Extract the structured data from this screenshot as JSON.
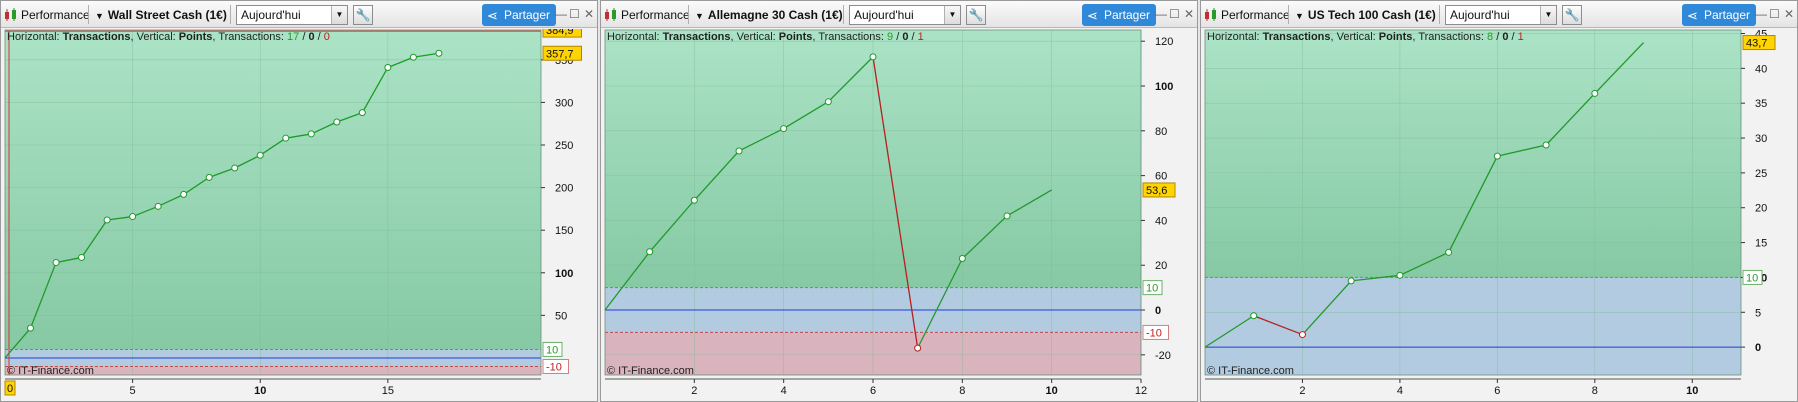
{
  "panels": [
    {
      "toolbar": {
        "perf": "Performance",
        "title": "Wall Street Cash (1€)",
        "period": "Aujourd'hui",
        "share": "Partager"
      },
      "info": {
        "h_label": "Horizontal: ",
        "h_val": "Transactions",
        "v_label": ", Vertical: ",
        "v_val": "Points",
        "t_label": ", Transactions: ",
        "t_win": "17",
        "sep1": " / ",
        "t_zero": "0",
        "sep2": " / ",
        "t_loss": "0"
      },
      "credit": "© IT-Finance.com",
      "markers": {
        "top": "384,9",
        "last": "357,7",
        "plus": "10",
        "minus": "-10",
        "x0": "0"
      }
    },
    {
      "toolbar": {
        "perf": "Performance",
        "title": "Allemagne 30 Cash (1€)",
        "period": "Aujourd'hui",
        "share": "Partager"
      },
      "info": {
        "h_label": "Horizontal: ",
        "h_val": "Transactions",
        "v_label": ", Vertical: ",
        "v_val": "Points",
        "t_label": ", Transactions: ",
        "t_win": "9",
        "sep1": " / ",
        "t_zero": "0",
        "sep2": " / ",
        "t_loss": "1"
      },
      "credit": "© IT-Finance.com",
      "markers": {
        "last": "53,6",
        "plus": "10",
        "minus": "-10"
      }
    },
    {
      "toolbar": {
        "perf": "Performance",
        "title": "US Tech 100 Cash (1€)",
        "period": "Aujourd'hui",
        "share": "Partager"
      },
      "info": {
        "h_label": "Horizontal: ",
        "h_val": "Transactions",
        "v_label": ", Vertical: ",
        "v_val": "Points",
        "t_label": ", Transactions: ",
        "t_win": "8",
        "sep1": " / ",
        "t_zero": "0",
        "sep2": " / ",
        "t_loss": "1"
      },
      "credit": "© IT-Finance.com",
      "markers": {
        "last": "43,7",
        "plus": "10"
      }
    }
  ],
  "chart_data": [
    {
      "type": "line",
      "title": "Wall Street Cash (1€)",
      "xlabel": "Transactions",
      "ylabel": "Points",
      "x": [
        0,
        1,
        2,
        3,
        4,
        5,
        6,
        7,
        8,
        9,
        10,
        11,
        12,
        13,
        14,
        15,
        16,
        17
      ],
      "y": [
        0,
        35,
        112,
        118,
        162,
        166,
        178,
        192,
        212,
        223,
        238,
        258,
        263,
        277,
        288,
        341,
        353,
        357.7
      ],
      "xlim": [
        0,
        21
      ],
      "ylim": [
        -20,
        385
      ],
      "xticks": [
        5,
        10,
        15
      ],
      "yticks": [
        50,
        100,
        150,
        200,
        250,
        300,
        350
      ],
      "bands": {
        "plus": 10,
        "minus": -10
      },
      "max_line": 384.9
    },
    {
      "type": "line",
      "title": "Allemagne 30 Cash (1€)",
      "xlabel": "Transactions",
      "ylabel": "Points",
      "x": [
        0,
        1,
        2,
        3,
        4,
        5,
        6,
        7,
        8,
        9,
        10
      ],
      "y": [
        0,
        26,
        49,
        71,
        81,
        93,
        113,
        -17,
        23,
        42,
        53.6
      ],
      "xlim": [
        0,
        12
      ],
      "ylim": [
        -29,
        125
      ],
      "xticks": [
        2,
        4,
        6,
        8,
        10,
        12
      ],
      "yticks": [
        -20,
        0,
        20,
        40,
        60,
        80,
        100,
        120
      ],
      "bands": {
        "plus": 10,
        "minus": -10
      }
    },
    {
      "type": "line",
      "title": "US Tech 100 Cash (1€)",
      "xlabel": "Transactions",
      "ylabel": "Points",
      "x": [
        0,
        1,
        2,
        3,
        4,
        5,
        6,
        7,
        8,
        9
      ],
      "y": [
        0,
        4.5,
        1.8,
        9.5,
        10.3,
        13.6,
        27.4,
        29,
        36.4,
        43.7
      ],
      "xlim": [
        0,
        11
      ],
      "ylim": [
        -4,
        45.5
      ],
      "xticks": [
        2,
        4,
        6,
        8,
        10
      ],
      "yticks": [
        0,
        5,
        10,
        15,
        20,
        25,
        30,
        35,
        40,
        45
      ],
      "bands": {
        "plus": 10
      }
    }
  ],
  "colors": {
    "green_zone": "#9fdcbc",
    "blue_zone": "#b3cbe0",
    "red_zone": "#d9b3bd",
    "line_up": "#1f9a2a",
    "line_down": "#b52020",
    "zero_line": "#1e3cd8",
    "marker_bg": "#ffd400"
  }
}
